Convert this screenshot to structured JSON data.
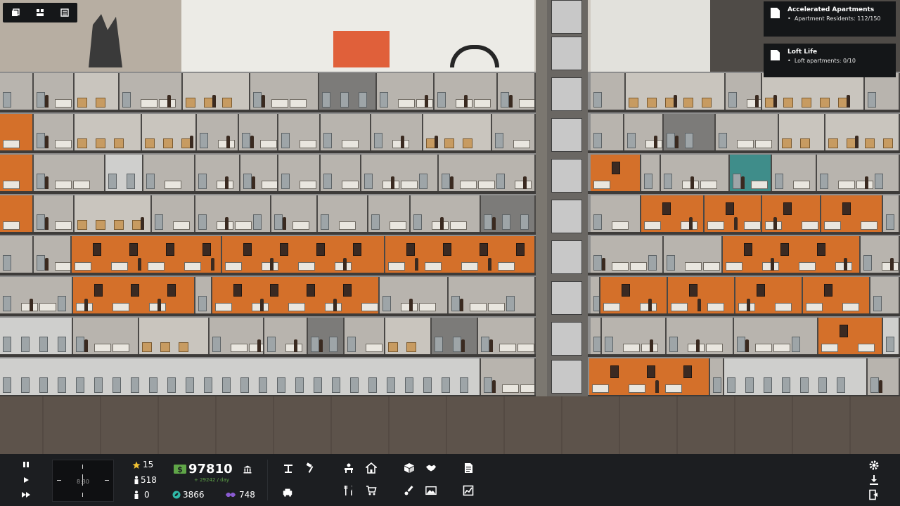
{
  "notifications": [
    {
      "title": "Accelerated Apartments",
      "line": "Apartment Residents: 112/150"
    },
    {
      "title": "Loft Life",
      "line": "Loft apartments: 0/10"
    }
  ],
  "hud": {
    "time": "8:30",
    "stars": "15",
    "workers": "518",
    "tenants_unhappy": "0",
    "money": "97810",
    "money_rate": "+ 29242 / day",
    "eco": "3866",
    "influence": "748"
  },
  "speed_controls": [
    "pause-icon",
    "play-icon",
    "fast-forward-icon"
  ],
  "top_left_tools": [
    "windowed-icon",
    "layout-icon",
    "list-icon"
  ],
  "toolbar_groups": [
    [
      "construct-icon",
      "hammer-icon",
      "elevator-car-icon"
    ],
    [
      "office-desk-icon",
      "home-icon",
      "restaurant-icon",
      "shop-cart-icon"
    ],
    [
      "crate-icon",
      "handshake-icon",
      "paint-brush-icon",
      "landscape-icon"
    ],
    [
      "document-icon",
      "stats-icon"
    ]
  ],
  "right_controls": [
    "settings-gear-icon",
    "download-icon",
    "exit-icon"
  ],
  "colors": {
    "hud_bg": "#1c1e21",
    "money_green": "#5fa548",
    "influence_purple": "#8a5bd1",
    "eco_teal": "#2fb9a8",
    "star_gold": "#f2c233",
    "room_orange": "#d4702a"
  }
}
